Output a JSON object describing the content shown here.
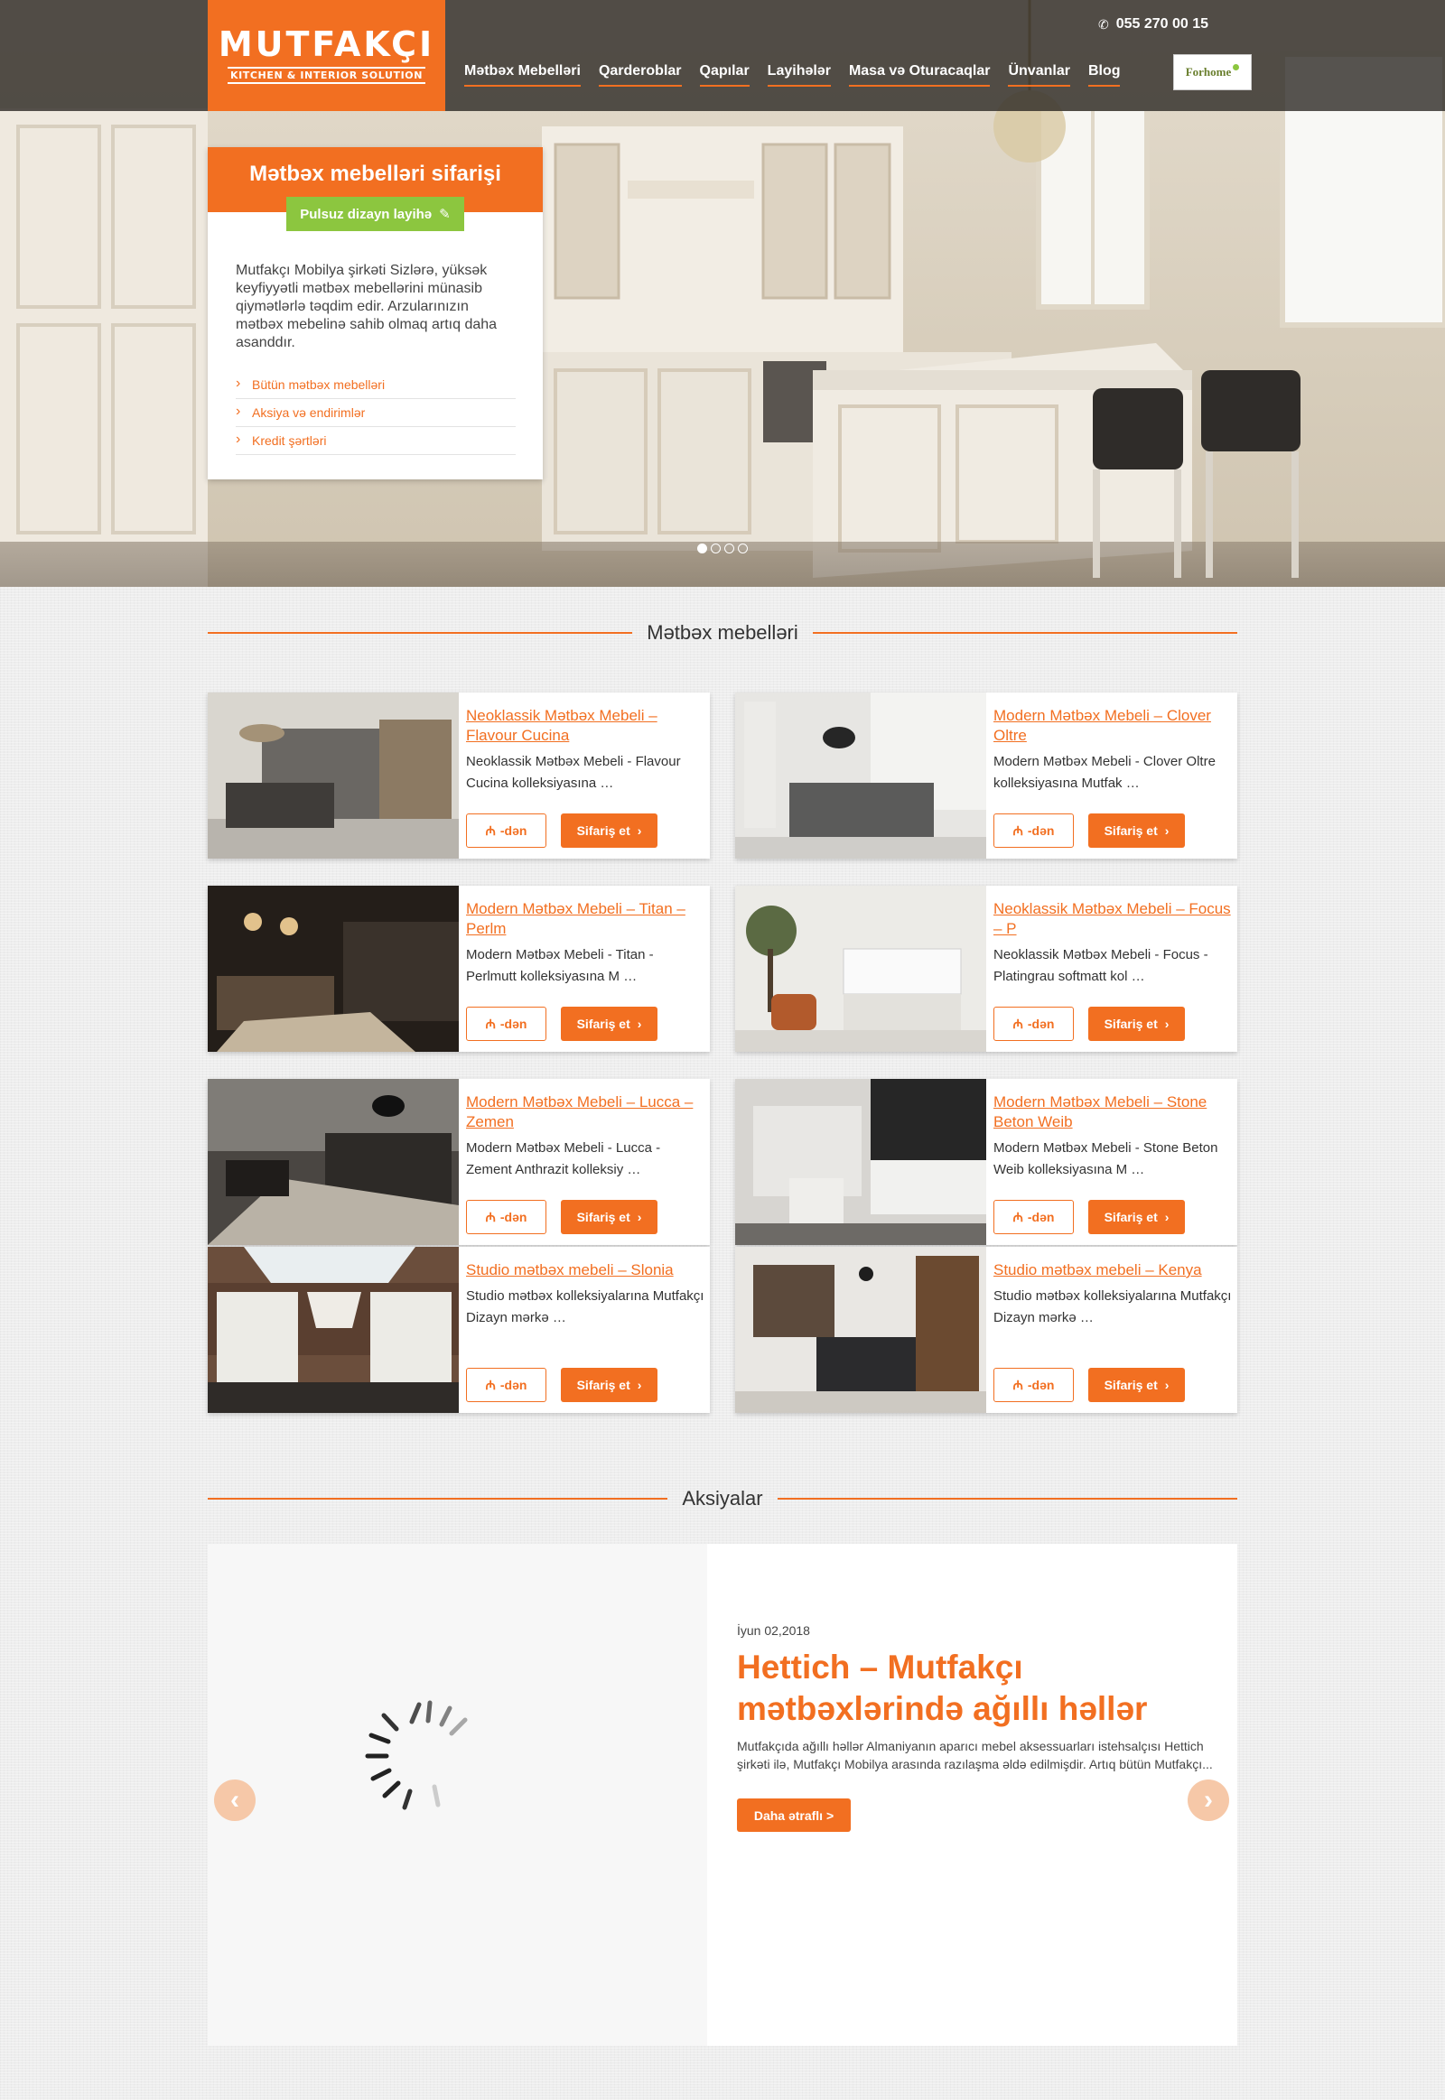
{
  "brand": {
    "name": "MUTFAKÇI",
    "tagline": "KITCHEN & INTERIOR SOLUTION",
    "accent": "#f26f21",
    "green": "#8cc63f"
  },
  "header": {
    "phone": "055 270 00 15",
    "nav": [
      "Mətbəx Mebelləri",
      "Qarderoblar",
      "Qapılar",
      "Layihələr",
      "Masa və Oturacaqlar",
      "Ünvanlar",
      "Blog"
    ],
    "partner_logo": "Forhome"
  },
  "hero": {
    "card_title": "Mətbəx mebelləri sifarişi",
    "design_button": "Pulsuz dizayn layihə",
    "text": "Mutfakçı Mobilya şirkəti Sizlərə, yüksək keyfiyyətli mətbəx mebellərini münasib qiymətlərlə təqdim edir. Arzularınızın mətbəx mebelinə sahib olmaq artıq daha asanddır.",
    "links": [
      "Bütün mətbəx mebelləri",
      "Aksiya və endirimlər",
      "Kredit şərtləri"
    ],
    "slides_total": 4,
    "slide_active": 1
  },
  "products_section": {
    "title": "Mətbəx mebelləri",
    "price_label": "-dən",
    "order_label": "Sifariş et",
    "items": [
      {
        "title": "Neoklassik Mətbəx Mebeli – Flavour Cucina",
        "desc": "Neoklassik Mətbəx Mebeli - Flavour Cucina kolleksiyasına …"
      },
      {
        "title": "Modern Mətbəx Mebeli – Clover Oltre",
        "desc": "Modern Mətbəx Mebeli - Clover Oltre kolleksiyasına Mutfak …"
      },
      {
        "title": "Modern Mətbəx Mebeli – Titan – Perlm",
        "desc": "Modern Mətbəx Mebeli - Titan - Perlmutt kolleksiyasına M …"
      },
      {
        "title": "Neoklassik Mətbəx Mebeli – Focus – P",
        "desc": "Neoklassik Mətbəx Mebeli - Focus - Platingrau softmatt kol …"
      },
      {
        "title": "Modern Mətbəx Mebeli – Lucca – Zemen",
        "desc": "Modern Mətbəx Mebeli - Lucca - Zement Anthrazit kolleksiy …"
      },
      {
        "title": "Modern Mətbəx Mebeli – Stone Beton Weib",
        "desc": "Modern Mətbəx Mebeli - Stone Beton Weib kolleksiyasına M …"
      },
      {
        "title": "Studio mətbəx mebeli – Slonia",
        "desc": "Studio mətbəx kolleksiyalarına Mutfakçı Dizayn mərkə …"
      },
      {
        "title": "Studio mətbəx mebeli – Kenya",
        "desc": "Studio mətbəx kolleksiyalarına Mutfakçı Dizayn mərkə …"
      }
    ]
  },
  "promo_section": {
    "title": "Aksiyalar",
    "date": "İyun 02,2018",
    "headline": "Hettich – Mutfakçı mətbəxlərində ağıllı həllər",
    "text": "Mutfakçıda ağıllı həllər Almaniyanın aparıcı mebel aksessuarları istehsalçısı Hettich şirkəti ilə, Mutfakçı Mobilya arasında razılaşma əldə edilmişdir. Artıq bütün Mutfakçı...",
    "more_label": "Daha ətraflı >"
  },
  "icons": {
    "phone": "phone-icon",
    "brush": "brush-icon",
    "arrow_right": "chevron-right-icon",
    "manat": "manat-icon",
    "spinner": "loading-spinner-icon"
  }
}
